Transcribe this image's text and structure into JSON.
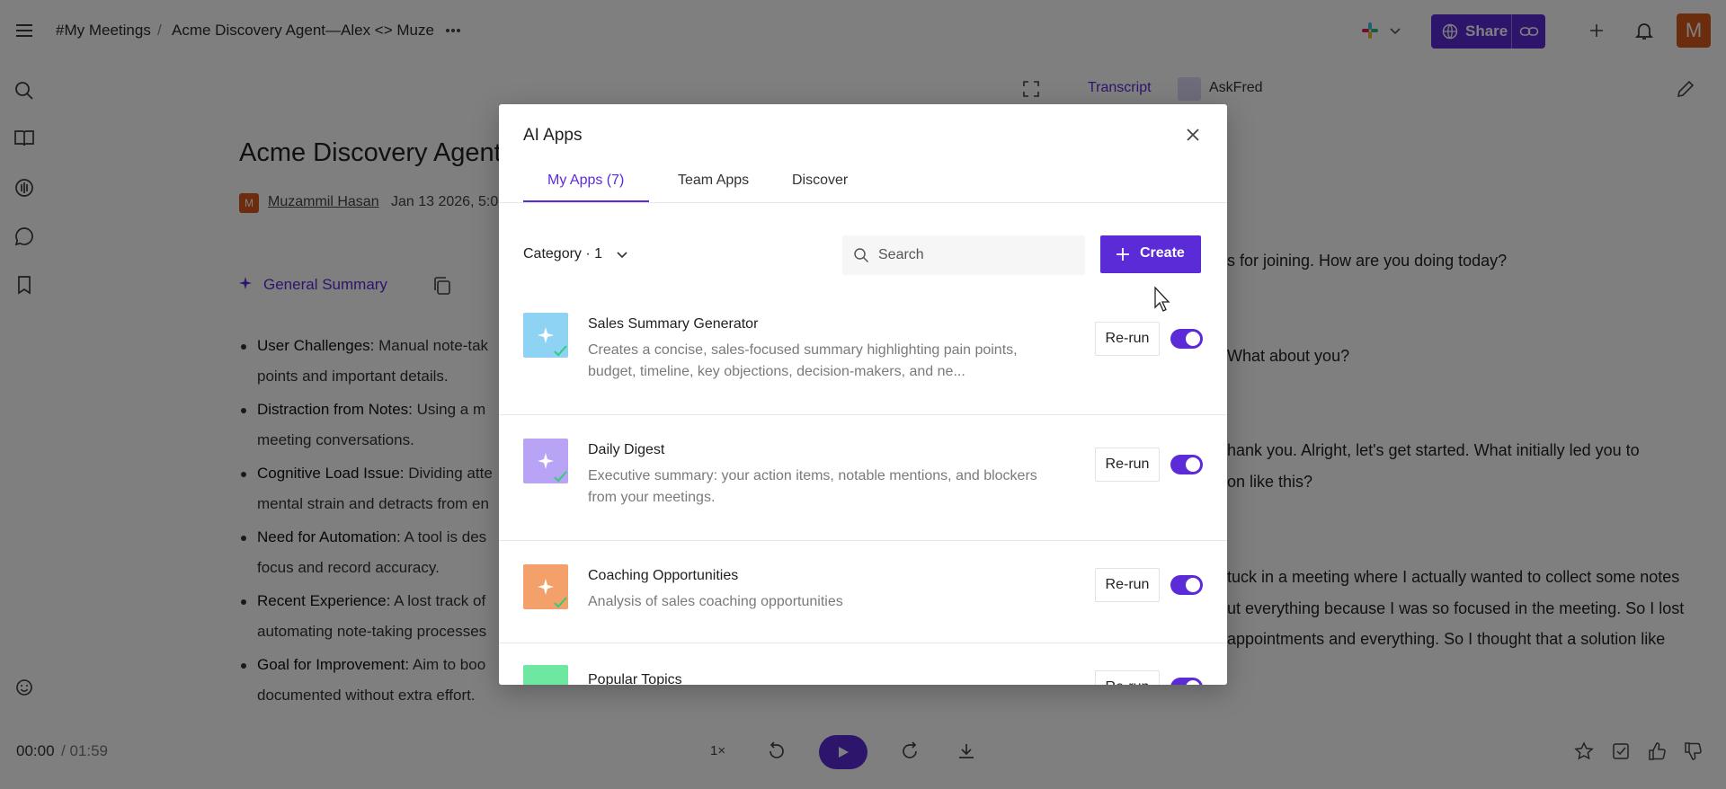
{
  "header": {
    "breadcrumb_root": "#My Meetings",
    "breadcrumb_sep": "/",
    "breadcrumb_current": "Acme Discovery Agent—Alex <> Muze",
    "share_label": "Share",
    "avatar_initial": "M"
  },
  "right_panel": {
    "transcript_tab": "Transcript",
    "askfred_tab": "AskFred",
    "lines": [
      "s for joining. How are you doing today?",
      "What about you?",
      "hank you. Alright, let's get started. What initially led you to",
      "on like this?",
      "tuck in a meeting where I actually wanted to collect some notes",
      "ut everything because I was so focused in the meeting. So I lost",
      "appointments and everything. So I thought that a solution like"
    ]
  },
  "document": {
    "title": "Acme Discovery Agent-",
    "author_initial": "M",
    "author": "Muzammil Hasan",
    "date": "Jan 13 2026, 5:0",
    "summary_selector": "General Summary",
    "bullets": [
      {
        "head": "User Challenges:",
        "text": " Manual note-tak",
        "cont": "points and important details."
      },
      {
        "head": "Distraction from Notes:",
        "text": " Using a m",
        "cont": "meeting conversations."
      },
      {
        "head": "Cognitive Load Issue:",
        "text": " Dividing atte",
        "cont": "mental strain and detracts from en"
      },
      {
        "head": "Need for Automation:",
        "text": " A tool is des",
        "cont": "focus and record accuracy."
      },
      {
        "head": "Recent Experience:",
        "text": " A lost track of",
        "cont": "automating note-taking processes"
      },
      {
        "head": "Goal for Improvement:",
        "text": " Aim to boo",
        "cont": "documented without extra effort."
      }
    ]
  },
  "player": {
    "time": "00:00",
    "duration": "/ 01:59",
    "speed": "1×"
  },
  "modal": {
    "title": "AI Apps",
    "tabs": [
      {
        "label": "My Apps (7)",
        "active": true
      },
      {
        "label": "Team Apps",
        "active": false
      },
      {
        "label": "Discover",
        "active": false
      }
    ],
    "category_label": "Category · 1",
    "search_placeholder": "Search",
    "create_label": "Create",
    "rerun_label": "Re-run",
    "apps": [
      {
        "name": "Sales Summary Generator",
        "desc": "Creates a concise, sales-focused summary highlighting pain points, budget, timeline, key objections, decision-makers, and ne...",
        "icon_color": "#8fd3f4",
        "enabled": true
      },
      {
        "name": "Daily Digest",
        "desc": "Executive summary: your action items, notable mentions, and blockers from your meetings.",
        "icon_color": "#b9a3f5",
        "enabled": true
      },
      {
        "name": "Coaching Opportunities",
        "desc": "Analysis of sales coaching opportunities",
        "icon_color": "#f4a06a",
        "enabled": true
      },
      {
        "name": "Popular Topics",
        "desc": "",
        "icon_color": "#6ee7a0",
        "enabled": true
      }
    ]
  },
  "colors": {
    "accent": "#5b2bd8",
    "check": "#2fcf7a"
  }
}
